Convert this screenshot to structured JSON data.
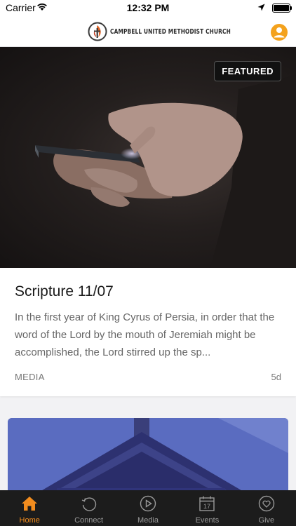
{
  "status_bar": {
    "carrier": "Carrier",
    "time": "12:32 PM"
  },
  "header": {
    "logo_text": "CAMPBELL UNITED METHODIST CHURCH",
    "profile_icon": "user-icon",
    "accent": "#f4a21d"
  },
  "featured_card": {
    "badge": "FEATURED",
    "title": "Scripture 11/07",
    "excerpt": "In the first year of King Cyrus of Persia, in order that the word of the Lord by the mouth of Jeremiah might be accomplished, the Lord stirred up the sp...",
    "category": "MEDIA",
    "age": "5d"
  },
  "tabs": [
    {
      "label": "Home",
      "icon": "home-icon",
      "active": true
    },
    {
      "label": "Connect",
      "icon": "connect-icon",
      "active": false
    },
    {
      "label": "Media",
      "icon": "play-icon",
      "active": false
    },
    {
      "label": "Events",
      "icon": "calendar-icon",
      "active": false,
      "calendar_day": "17"
    },
    {
      "label": "Give",
      "icon": "heart-icon",
      "active": false
    }
  ],
  "colors": {
    "tab_active": "#f28c1e",
    "tab_inactive": "#9a9a9a",
    "tab_bar_bg": "#1c1c1c"
  }
}
